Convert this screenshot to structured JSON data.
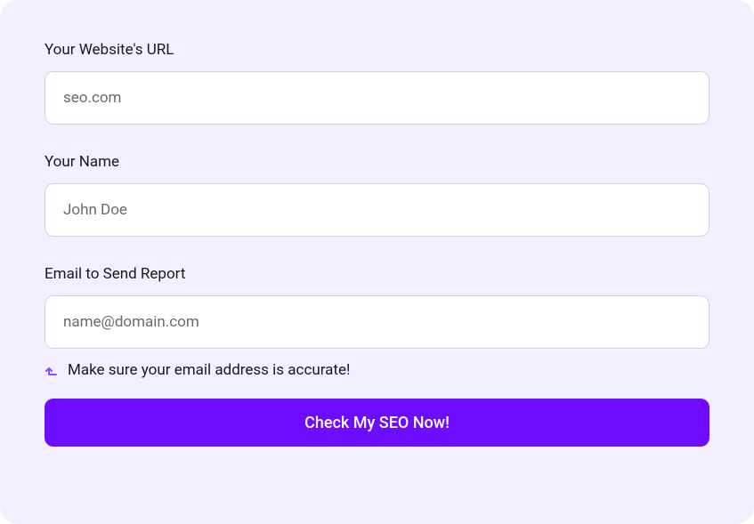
{
  "form": {
    "fields": {
      "url": {
        "label": "Your Website's URL",
        "placeholder": "seo.com",
        "value": ""
      },
      "name": {
        "label": "Your Name",
        "placeholder": "John Doe",
        "value": ""
      },
      "email": {
        "label": "Email to Send Report",
        "placeholder": "name@domain.com",
        "value": "",
        "helper": "Make sure your email address is accurate!"
      }
    },
    "submit_label": "Check My SEO Now!"
  },
  "colors": {
    "accent": "#6d0cff",
    "bg": "#f4efff"
  }
}
